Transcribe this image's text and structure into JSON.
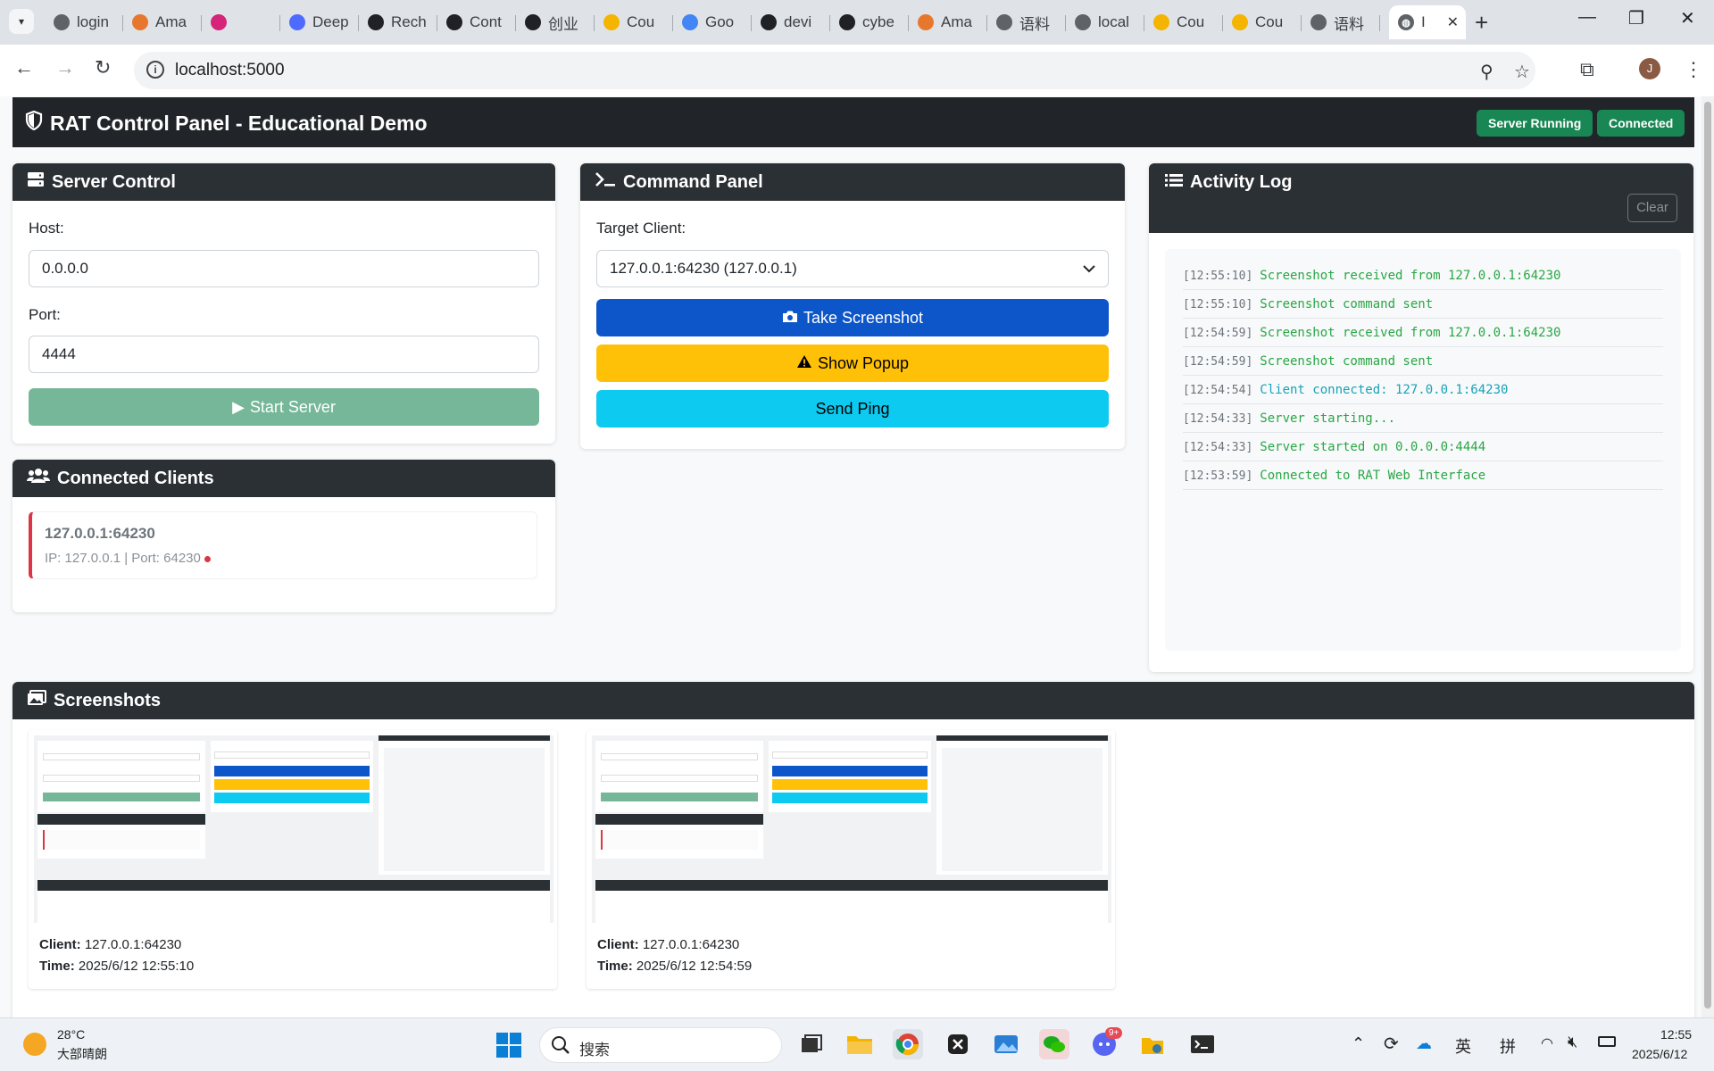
{
  "browser": {
    "tabs": [
      {
        "label": "login",
        "color": "#5f6368"
      },
      {
        "label": "Ama",
        "color": "#e8772e"
      },
      {
        "label": "",
        "color": "#d6247a"
      },
      {
        "label": "Deep",
        "color": "#4d6bfe"
      },
      {
        "label": "Rech",
        "color": "#202124"
      },
      {
        "label": "Cont",
        "color": "#202124"
      },
      {
        "label": "创业",
        "color": "#202124"
      },
      {
        "label": "Cou",
        "color": "#f4b400"
      },
      {
        "label": "Goo",
        "color": "#4285f4"
      },
      {
        "label": "devi",
        "color": "#202124"
      },
      {
        "label": "cybe",
        "color": "#202124"
      },
      {
        "label": "Ama",
        "color": "#e8772e"
      },
      {
        "label": "语料",
        "color": "#5f6368"
      },
      {
        "label": "local",
        "color": "#5f6368"
      },
      {
        "label": "Cou",
        "color": "#f4b400"
      },
      {
        "label": "Cou",
        "color": "#f4b400"
      },
      {
        "label": "语料",
        "color": "#5f6368"
      }
    ],
    "active_tab_label": "I",
    "url": "localhost:5000"
  },
  "app": {
    "title": "RAT Control Panel - Educational Demo",
    "status_server": "Server Running",
    "status_connection": "Connected"
  },
  "server_control": {
    "header": "Server Control",
    "host_label": "Host:",
    "host_value": "0.0.0.0",
    "port_label": "Port:",
    "port_value": "4444",
    "start_button": "Start Server"
  },
  "command_panel": {
    "header": "Command Panel",
    "target_label": "Target Client:",
    "target_value": "127.0.0.1:64230 (127.0.0.1)",
    "screenshot_button": "Take Screenshot",
    "popup_button": "Show Popup",
    "ping_button": "Send Ping"
  },
  "activity_log": {
    "header": "Activity Log",
    "clear_button": "Clear",
    "entries": [
      {
        "time": "[12:55:10]",
        "message": "Screenshot received from 127.0.0.1:64230",
        "color": "#28a745"
      },
      {
        "time": "[12:55:10]",
        "message": "Screenshot command sent",
        "color": "#28a745"
      },
      {
        "time": "[12:54:59]",
        "message": "Screenshot received from 127.0.0.1:64230",
        "color": "#28a745"
      },
      {
        "time": "[12:54:59]",
        "message": "Screenshot command sent",
        "color": "#28a745"
      },
      {
        "time": "[12:54:54]",
        "message": "Client connected: 127.0.0.1:64230",
        "color": "#17a2b8"
      },
      {
        "time": "[12:54:33]",
        "message": "Server starting...",
        "color": "#28a745"
      },
      {
        "time": "[12:54:33]",
        "message": "Server started on 0.0.0.0:4444",
        "color": "#28a745"
      },
      {
        "time": "[12:53:59]",
        "message": "Connected to RAT Web Interface",
        "color": "#28a745"
      }
    ]
  },
  "clients": {
    "header": "Connected Clients",
    "items": [
      {
        "address": "127.0.0.1:64230",
        "meta": "IP: 127.0.0.1 | Port: 64230"
      }
    ]
  },
  "screenshots": {
    "header": "Screenshots",
    "client_label": "Client:",
    "time_label": "Time:",
    "items": [
      {
        "client": "127.0.0.1:64230",
        "time": "2025/6/12 12:55:10"
      },
      {
        "client": "127.0.0.1:64230",
        "time": "2025/6/12 12:54:59"
      }
    ]
  },
  "taskbar": {
    "weather_temp": "28°C",
    "weather_desc": "大部晴朗",
    "search_placeholder": "搜索",
    "ime_lang": "英",
    "ime_mode": "拼",
    "clock_time": "12:55",
    "clock_date": "2025/6/12",
    "notification_badge": "9+"
  },
  "colors": {
    "primary": "#0d56c9",
    "warning": "#ffc107",
    "info": "#0dcaf0",
    "success": "#198754",
    "start_button": "#75b798",
    "dark": "#212529"
  }
}
